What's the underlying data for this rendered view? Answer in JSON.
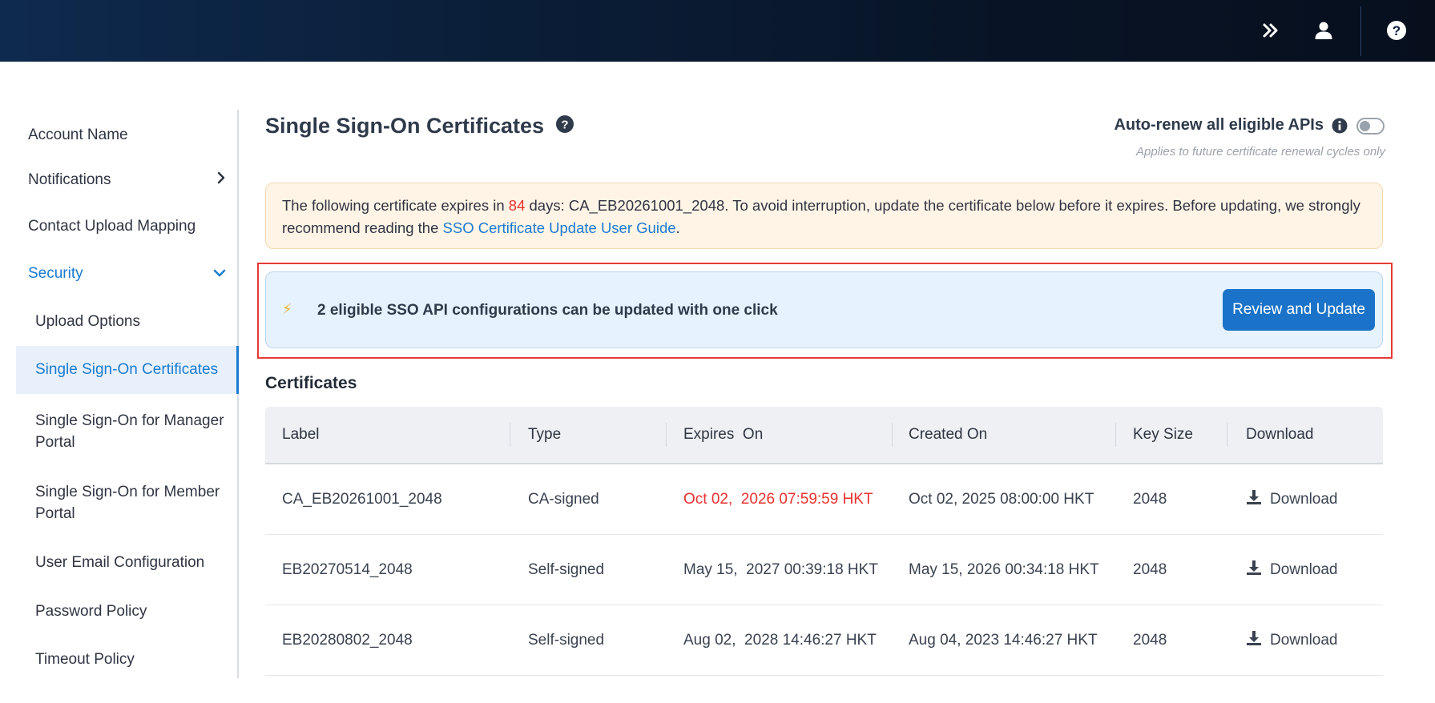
{
  "topbar": {
    "icons": [
      "double-chevron-right-icon",
      "user-icon",
      "help-icon"
    ]
  },
  "sidebar": {
    "items": [
      {
        "label": "Account Name"
      },
      {
        "label": "Notifications"
      },
      {
        "label": "Contact Upload Mapping"
      },
      {
        "label": "Security"
      },
      {
        "label": "Upload Options"
      },
      {
        "label": "Single Sign-On Certificates"
      },
      {
        "label": "Single Sign-On for Manager Portal"
      },
      {
        "label": "Single Sign-On for Member Portal"
      },
      {
        "label": "User Email Configuration"
      },
      {
        "label": "Password Policy"
      },
      {
        "label": "Timeout Policy"
      }
    ]
  },
  "page": {
    "title": "Single Sign-On Certificates",
    "auto_renew_label": "Auto-renew all eligible APIs",
    "auto_renew_enabled": false,
    "auto_renew_note": "Applies to future certificate renewal cycles only"
  },
  "warning": {
    "prefix": "The following certificate expires in ",
    "days": "84",
    "middle": " days: CA_EB20261001_2048. To avoid interruption, update the certificate below before it expires. Before updating, we strongly recommend reading the ",
    "link": "SSO Certificate Update User Guide",
    "suffix": "."
  },
  "oneclick": {
    "message": "2 eligible SSO API configurations can be updated with one click",
    "button": "Review and Update"
  },
  "certificates": {
    "title": "Certificates",
    "columns": [
      "Label",
      "Type",
      "Expires  On",
      "Created On",
      "Key Size",
      "Download"
    ],
    "rows": [
      {
        "label": "CA_EB20261001_2048",
        "type": "CA-signed",
        "expires": "Oct 02,  2026 07:59:59 HKT",
        "created": "Oct 02, 2025 08:00:00 HKT",
        "key_size": "2048",
        "download": "Download"
      },
      {
        "label": "EB20270514_2048",
        "type": "Self-signed",
        "expires": "May 15,  2027 00:39:18 HKT",
        "created": "May 15, 2026 00:34:18 HKT",
        "key_size": "2048",
        "download": "Download"
      },
      {
        "label": "EB20280802_2048",
        "type": "Self-signed",
        "expires": "Aug 02,  2028 14:46:27 HKT",
        "created": "Aug 04, 2023 14:46:27 HKT",
        "key_size": "2048",
        "download": "Download"
      }
    ]
  },
  "colors": {
    "accent": "#1a73c8",
    "link": "#1a7bd1",
    "danger": "#e8322f",
    "warning_bg": "#fff4e6",
    "info_bg": "#e6f2fd",
    "highlight_border": "#e53935"
  }
}
